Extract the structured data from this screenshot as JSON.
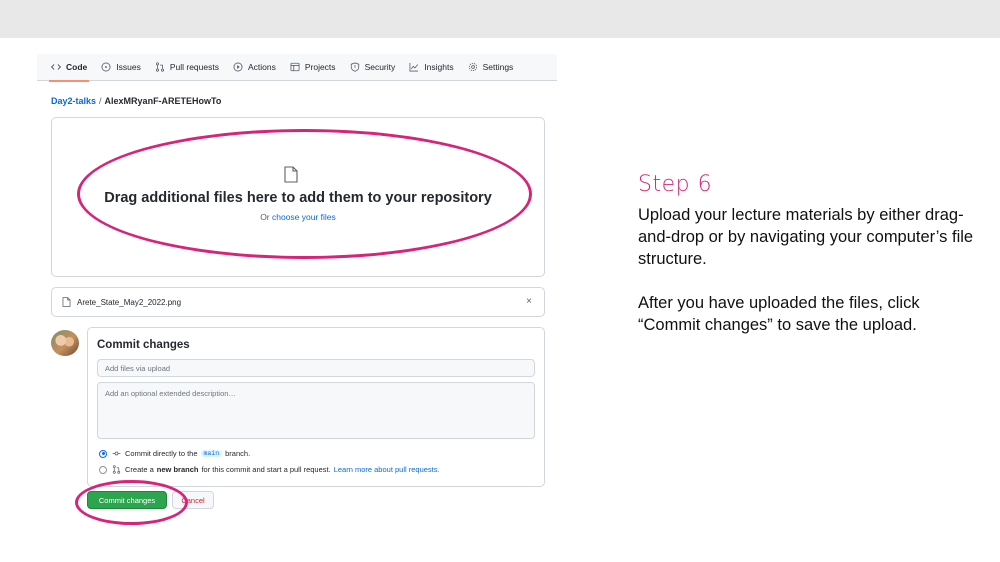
{
  "nav": {
    "items": [
      {
        "label": "Code",
        "icon": "code-icon"
      },
      {
        "label": "Issues",
        "icon": "issue-icon"
      },
      {
        "label": "Pull requests",
        "icon": "pull-request-icon"
      },
      {
        "label": "Actions",
        "icon": "play-icon"
      },
      {
        "label": "Projects",
        "icon": "table-icon"
      },
      {
        "label": "Security",
        "icon": "shield-icon"
      },
      {
        "label": "Insights",
        "icon": "graph-icon"
      },
      {
        "label": "Settings",
        "icon": "gear-icon"
      }
    ],
    "active": "Code"
  },
  "breadcrumb": {
    "owner": "Day2-talks",
    "separator": "/",
    "repo": "AlexMRyanF-ARETEHowTo"
  },
  "dropzone": {
    "title": "Drag additional files here to add them to your repository",
    "sub_prefix": "Or ",
    "sub_link": "choose your files",
    "icon": "file-icon"
  },
  "uploaded_file": {
    "name": "Arete_State_May2_2022.png",
    "remove_label": "×",
    "icon": "file-icon"
  },
  "commit": {
    "title": "Commit changes",
    "summary_placeholder": "Add files via upload",
    "description_placeholder": "Add an optional extended description…",
    "option_direct_prefix": "Commit directly to the",
    "branch_name": "main",
    "option_direct_suffix": "branch.",
    "option_new_prefix": "Create a",
    "option_new_bold": "new branch",
    "option_new_suffix": "for this commit and start a pull request.",
    "option_new_link": "Learn more about pull requests.",
    "commit_button": "Commit changes",
    "cancel_button": "Cancel"
  },
  "instructions": {
    "step": "Step 6",
    "paragraph1": "Upload your lecture materials by either drag-and-drop or by navigating your computer’s file structure.",
    "paragraph2": "After you have uploaded the files, click “Commit changes” to save the upload."
  },
  "colors": {
    "highlight": "#d6247a",
    "commit_button": "#2da44e",
    "link": "#0969da"
  }
}
